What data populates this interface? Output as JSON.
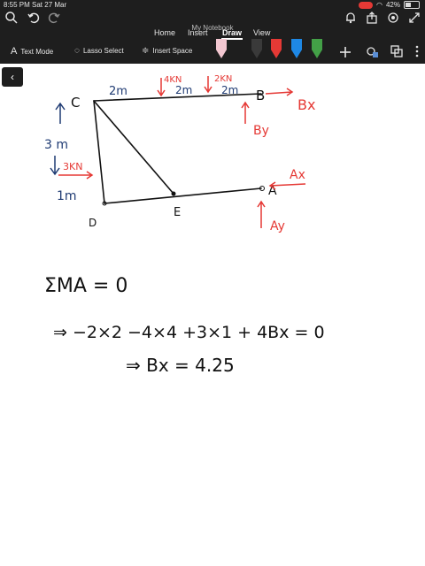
{
  "status": {
    "time": "8:55 PM  Sat 27 Mar",
    "battery": "42%",
    "battery_level": 0.42
  },
  "app": {
    "title": "My Notebook"
  },
  "tabs": [
    {
      "label": "Home"
    },
    {
      "label": "Insert"
    },
    {
      "label": "Draw",
      "active": true
    },
    {
      "label": "View"
    }
  ],
  "toolbar": {
    "text_mode": "Text Mode",
    "lasso_select": "Lasso Select",
    "insert_space": "Insert Space"
  },
  "pens": [
    {
      "color": "#f3c7d1"
    },
    {
      "color": "#3a3a3a"
    },
    {
      "color": "#e53935"
    },
    {
      "color": "#1e88e5"
    },
    {
      "color": "#43a047"
    },
    {
      "color": "#1565c0"
    }
  ],
  "ink": {
    "diagram_labels": {
      "c": "C",
      "b": "B",
      "d": "D",
      "e": "E",
      "a": "A",
      "len_cb_left": "2m",
      "len_mid": "2m",
      "len_right": "2m",
      "load_4kn": "4KN",
      "load_2kn": "2KN",
      "height_3m": "3 m",
      "load_3kn": "3KN",
      "len_1m": "1m",
      "bx": "Bx",
      "by": "By",
      "ax": "Ax",
      "ay": "Ay"
    },
    "equation1": "ΣMA = 0",
    "equation2": "⇒ −2×2 −4×4 +3×1 + 4Bx = 0",
    "equation3": "⇒ Bx = 4.25"
  }
}
